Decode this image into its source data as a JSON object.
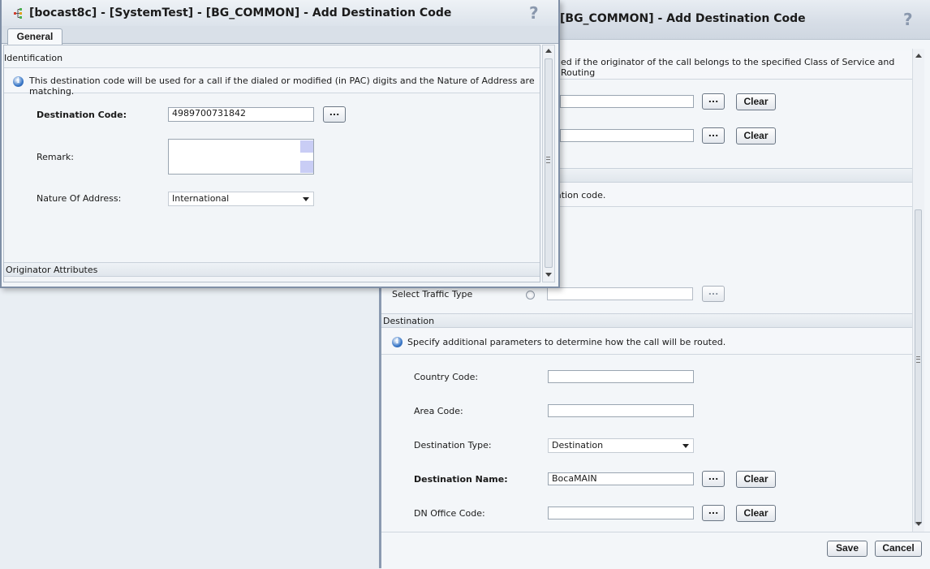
{
  "back_window": {
    "title": "[BG_COMMON] - Add Destination Code",
    "help_icon": "?",
    "originator_info_partial": "ed if the originator of the call belongs to the specified Class of Service and Routing",
    "row1_clear": "Clear",
    "row2_clear": "Clear",
    "ellipsis": "...",
    "partial_info2": "ation code.",
    "traffic": {
      "label": "Select Traffic Type",
      "value": ""
    },
    "destination": {
      "section_title": "Destination",
      "info": "Specify additional parameters to determine how the call will be routed.",
      "country_code": {
        "label": "Country Code:",
        "value": ""
      },
      "area_code": {
        "label": "Area Code:",
        "value": ""
      },
      "destination_type": {
        "label": "Destination Type:",
        "value": "Destination"
      },
      "destination_name": {
        "label": "Destination Name:",
        "value": "BocaMAIN",
        "clear": "Clear"
      },
      "dn_office_code": {
        "label": "DN Office Code:",
        "value": "",
        "clear": "Clear"
      }
    },
    "footer": {
      "save": "Save",
      "cancel": "Cancel"
    }
  },
  "front_window": {
    "title": "[bocast8c] - [SystemTest] - [BG_COMMON] - Add Destination Code",
    "help_icon": "?",
    "tabs": [
      {
        "label": "General",
        "active": true
      }
    ],
    "identification": {
      "section_title": "Identification",
      "info": "This destination code will be used for a call if the dialed or modified (in PAC) digits and the Nature of Address are matching.",
      "destination_code": {
        "label": "Destination Code:",
        "value": "4989700731842",
        "button": "..."
      },
      "remark": {
        "label": "Remark:",
        "value": ""
      },
      "nature_of_address": {
        "label": "Nature Of Address:",
        "value": "International"
      }
    },
    "originator_section_title": "Originator Attributes"
  },
  "icons": [
    "app-icon",
    "help-icon",
    "info-icon",
    "chevron-down-icon",
    "scroll-up-icon",
    "scroll-down-icon"
  ]
}
